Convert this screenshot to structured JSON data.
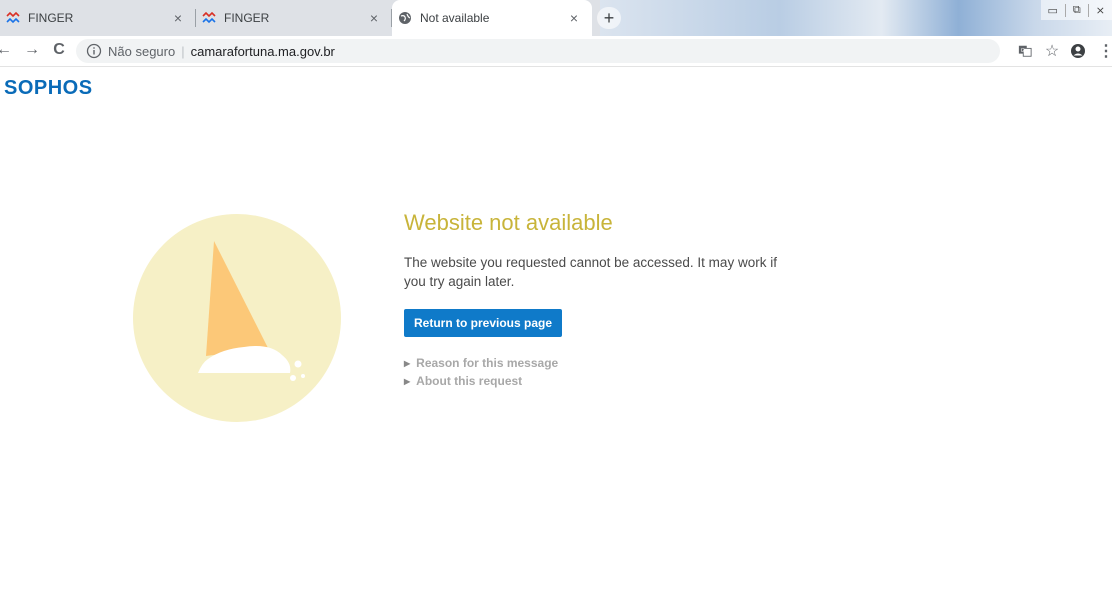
{
  "tabs": [
    {
      "title": "FINGER",
      "favicon": "finger-favicon-icon",
      "close": "×",
      "active": false
    },
    {
      "title": "FINGER",
      "favicon": "finger-favicon-icon",
      "close": "×",
      "active": false
    },
    {
      "title": "Not available",
      "favicon": "globe-favicon-icon",
      "close": "×",
      "active": true
    }
  ],
  "new_tab_label": "+",
  "toolbar": {
    "back": "←",
    "forward": "→",
    "reload": "C",
    "security_label": "Não seguro",
    "url": "camarafortuna.ma.gov.br",
    "separator": "|"
  },
  "page": {
    "brand": "SOPHOS",
    "heading": "Website not available",
    "message": "The website you requested cannot be accessed. It may work if you try again later.",
    "return_button": "Return to previous page",
    "details": [
      {
        "label": "Reason for this message"
      },
      {
        "label": "About this request"
      }
    ]
  },
  "colors": {
    "brand": "#0a6bb8",
    "heading": "#c8b43a",
    "button": "#0f7ac9",
    "circle": "#f6f0c6",
    "cone": "#fcc878"
  }
}
